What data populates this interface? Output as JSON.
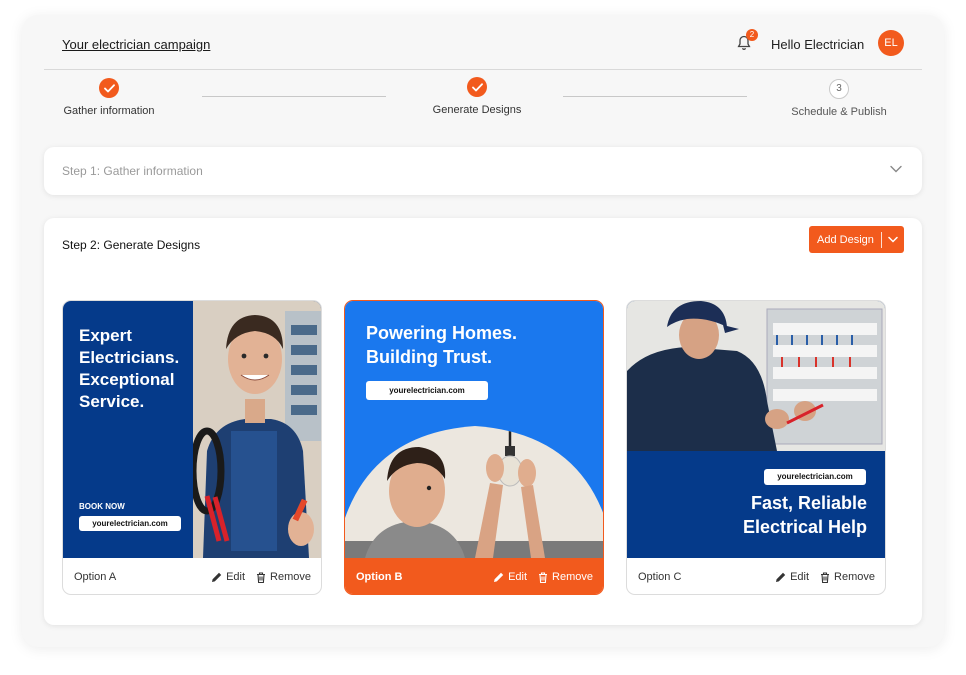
{
  "header": {
    "campaign_title": "Your electrician campaign",
    "notification_count": "2",
    "greeting": "Hello Electrician",
    "avatar_initials": "EL",
    "bell_icon": "bell-icon"
  },
  "stepper": {
    "steps": [
      {
        "label": "Gather information",
        "state": "done"
      },
      {
        "label": "Generate Designs",
        "state": "done"
      },
      {
        "label": "Schedule & Publish",
        "number": "3",
        "state": "todo"
      }
    ]
  },
  "step1": {
    "title": "Step 1: Gather information",
    "icon": "chevron-down-icon"
  },
  "step2": {
    "title": "Step 2: Generate Designs",
    "add_design_label": "Add Design",
    "designs": [
      {
        "option": "Option A",
        "headline_lines": [
          "Expert",
          "Electricians.",
          "Exceptional",
          "Service."
        ],
        "cta": "BOOK NOW",
        "url": "yourelectrician.com",
        "edit_label": "Edit",
        "remove_label": "Remove"
      },
      {
        "option": "Option B",
        "headline_lines": [
          "Powering Homes.",
          "Building Trust."
        ],
        "url": "yourelectrician.com",
        "edit_label": "Edit",
        "remove_label": "Remove",
        "selected": true
      },
      {
        "option": "Option C",
        "headline_lines": [
          "Fast, Reliable",
          "Electrical Help"
        ],
        "url": "yourelectrician.com",
        "edit_label": "Edit",
        "remove_label": "Remove"
      }
    ]
  },
  "colors": {
    "accent": "#f25a1d",
    "navy": "#053a8a",
    "blue": "#1a78ee"
  }
}
